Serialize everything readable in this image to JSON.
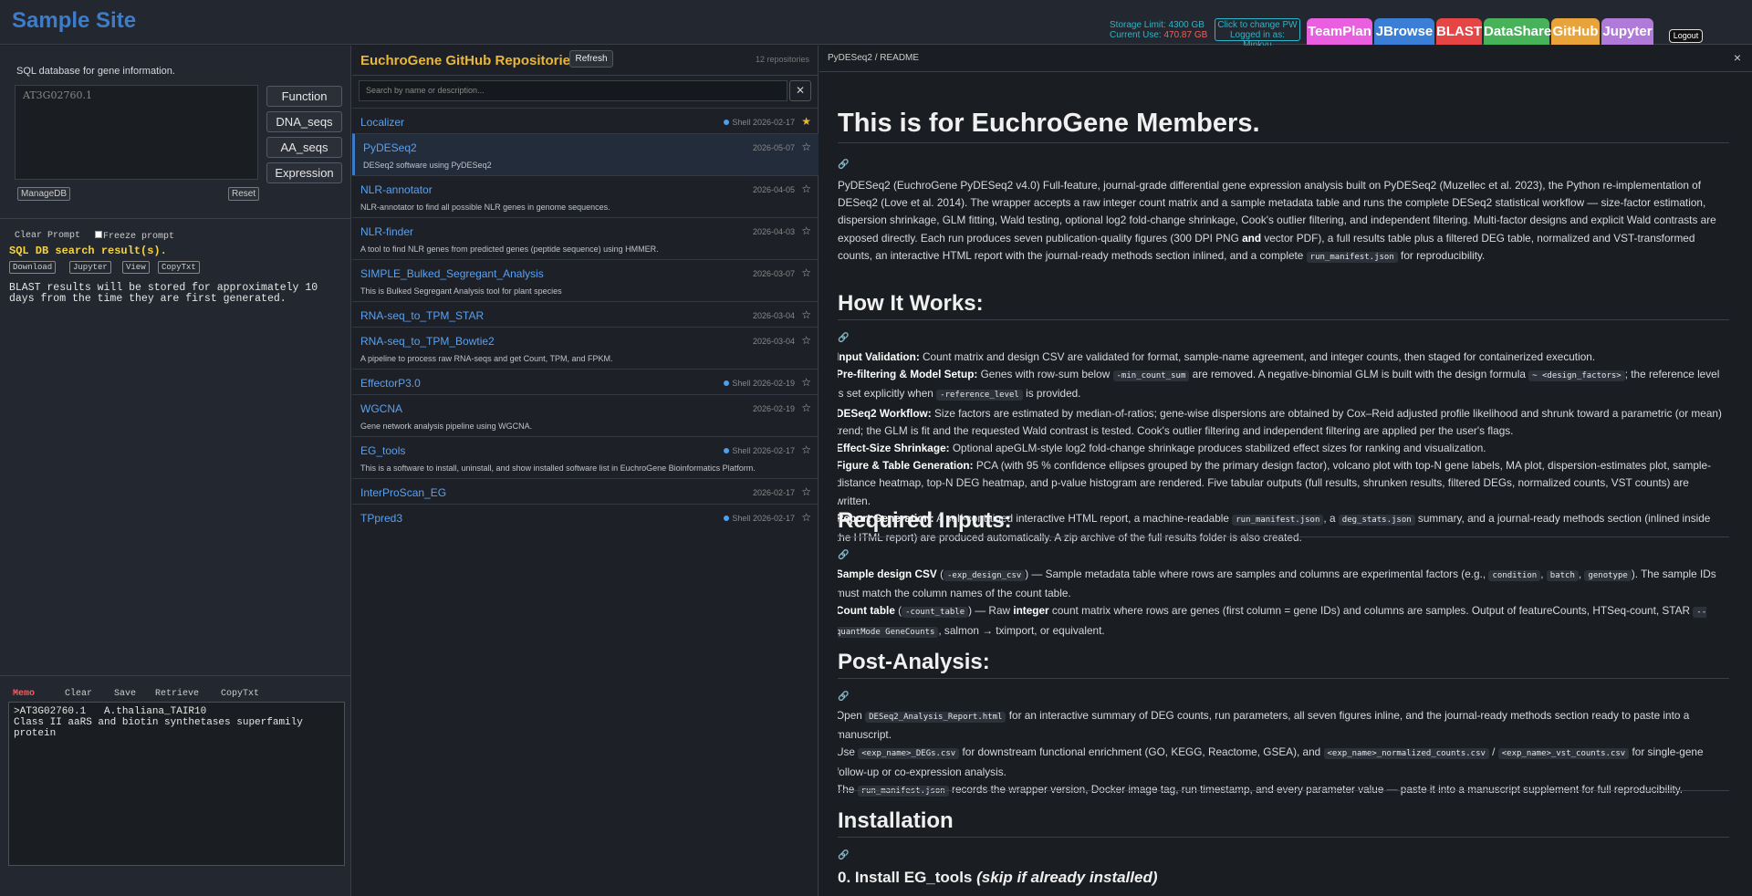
{
  "header": {
    "site_title": "Sample Site",
    "storage_limit_label": "Storage Limit:",
    "storage_limit_value": "4300 GB",
    "current_use_label": "Current Use:",
    "current_use_value": "470.87 GB",
    "pw_line1": "Click to change PW",
    "pw_line2": "Logged in as: Minkyu",
    "nav": [
      {
        "label": "TeamPlan",
        "color": "#e95fe0"
      },
      {
        "label": "JBrowse",
        "color": "#3b7ed6"
      },
      {
        "label": "BLAST",
        "color": "#e64545"
      },
      {
        "label": "DataShare",
        "color": "#47b25a"
      },
      {
        "label": "GitHub",
        "color": "#e8a43a"
      },
      {
        "label": "Jupyter",
        "color": "#b07ad9"
      }
    ],
    "logout": "Logout"
  },
  "sql": {
    "label": "SQL database for gene information.",
    "query": "AT3G02760.1",
    "buttons": [
      "Function",
      "DNA_seqs",
      "AA_seqs",
      "Expression"
    ],
    "managedb": "ManageDB",
    "reset": "Reset"
  },
  "results": {
    "clear_prompt": "Clear Prompt",
    "freeze_prompt": "Freeze prompt",
    "search_result": "SQL DB search result(s).",
    "buttons": [
      "Download",
      "Jupyter",
      "View",
      "CopyTxt"
    ],
    "note": "BLAST results will be stored for approximately 10 days from the time they are first generated."
  },
  "memo": {
    "tabs": [
      "Memo",
      "Clear",
      "Save",
      "Retrieve",
      "CopyTxt"
    ],
    "text": ">AT3G02760.1   A.thaliana_TAIR10\nClass II aaRS and biotin synthetases superfamily\nprotein"
  },
  "repos": {
    "title": "EuchroGene GitHub Repositories",
    "refresh": "Refresh",
    "count": "12 repositories",
    "search_placeholder": "Search by name or description...",
    "clear": "✕",
    "items": [
      {
        "name": "Localizer",
        "desc": "",
        "lang": "Shell",
        "date": "2026-02-17",
        "starred": true
      },
      {
        "name": "PyDESeq2",
        "desc": "DESeq2 software using PyDESeq2",
        "lang": "",
        "date": "2026-05-07",
        "starred": false
      },
      {
        "name": "NLR-annotator",
        "desc": "NLR-annotator to find all possible NLR genes in genome sequences.",
        "lang": "",
        "date": "2026-04-05",
        "starred": false
      },
      {
        "name": "NLR-finder",
        "desc": "A tool to find NLR genes from predicted genes (peptide sequence) using HMMER.",
        "lang": "",
        "date": "2026-04-03",
        "starred": false
      },
      {
        "name": "SIMPLE_Bulked_Segregant_Analysis",
        "desc": "This is Bulked Segregant Analysis tool for plant species",
        "lang": "",
        "date": "2026-03-07",
        "starred": false
      },
      {
        "name": "RNA-seq_to_TPM_STAR",
        "desc": "",
        "lang": "",
        "date": "2026-03-04",
        "starred": false
      },
      {
        "name": "RNA-seq_to_TPM_Bowtie2",
        "desc": "A pipeline to process raw RNA-seqs and get Count, TPM, and FPKM.",
        "lang": "",
        "date": "2026-03-04",
        "starred": false
      },
      {
        "name": "EffectorP3.0",
        "desc": "",
        "lang": "Shell",
        "date": "2026-02-19",
        "starred": false
      },
      {
        "name": "WGCNA",
        "desc": "Gene network analysis pipeline using WGCNA.",
        "lang": "",
        "date": "2026-02-19",
        "starred": false
      },
      {
        "name": "EG_tools",
        "desc": "This is a software to install, uninstall, and show installed software list in EuchroGene Bioinformatics Platform.",
        "lang": "Shell",
        "date": "2026-02-17",
        "starred": false
      },
      {
        "name": "InterProScan_EG",
        "desc": "",
        "lang": "",
        "date": "2026-02-17",
        "starred": false
      },
      {
        "name": "TPpred3",
        "desc": "",
        "lang": "Shell",
        "date": "2026-02-17",
        "starred": false
      }
    ]
  },
  "readme": {
    "path": "PyDESeq2 / README",
    "close": "×",
    "h1": "This is for EuchroGene Members.",
    "h_how": "How It Works:",
    "h_req": "Required Inputs:",
    "h_post": "Post-Analysis:",
    "h_install": "Installation",
    "h_install_sub": "0. Install EG_tools",
    "h_install_sub_note": "(skip if already installed)"
  }
}
